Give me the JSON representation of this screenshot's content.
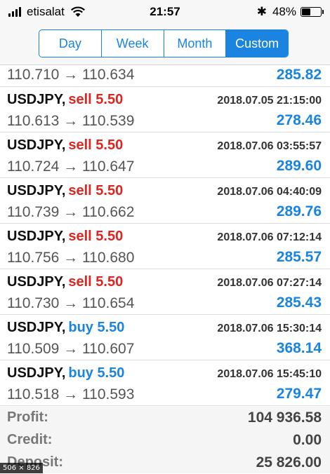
{
  "status": {
    "carrier": "etisalat",
    "time": "21:57",
    "battery": "48%",
    "battery_level": 0.48,
    "bluetooth_glyph": "✱"
  },
  "tabs": [
    {
      "label": "Day",
      "active": false
    },
    {
      "label": "Week",
      "active": false
    },
    {
      "label": "Month",
      "active": false
    },
    {
      "label": "Custom",
      "active": true
    }
  ],
  "trades": [
    {
      "prices": "110.710 → 110.634",
      "profit": "285.82"
    },
    {
      "symbol": "USDJPY,",
      "side": "sell 5.50",
      "time": "2018.07.05 21:15:00",
      "prices": "110.613 → 110.539",
      "profit": "278.46"
    },
    {
      "symbol": "USDJPY,",
      "side": "sell 5.50",
      "time": "2018.07.06 03:55:57",
      "prices": "110.724 → 110.647",
      "profit": "289.60"
    },
    {
      "symbol": "USDJPY,",
      "side": "sell 5.50",
      "time": "2018.07.06 04:40:09",
      "prices": "110.739 → 110.662",
      "profit": "289.76"
    },
    {
      "symbol": "USDJPY,",
      "side": "sell 5.50",
      "time": "2018.07.06 07:12:14",
      "prices": "110.756 → 110.680",
      "profit": "285.57"
    },
    {
      "symbol": "USDJPY,",
      "side": "sell 5.50",
      "time": "2018.07.06 07:27:14",
      "prices": "110.730 → 110.654",
      "profit": "285.43"
    },
    {
      "symbol": "USDJPY,",
      "side": "buy 5.50",
      "time": "2018.07.06 15:30:14",
      "prices": "110.509 → 110.607",
      "profit": "368.14"
    },
    {
      "symbol": "USDJPY,",
      "side": "buy 5.50",
      "time": "2018.07.06 15:45:10",
      "prices": "110.518 → 110.593",
      "profit": "279.47"
    }
  ],
  "summary": {
    "profit_label": "Profit:",
    "profit_value": "104 936.58",
    "credit_label": "Credit:",
    "credit_value": "0.00",
    "deposit_label": "Deposit:",
    "deposit_value": "25 826.00"
  },
  "overlay": {
    "size_badge": "506 × 826"
  },
  "colors": {
    "accent": "#1a84e0",
    "sell": "#e0241f",
    "buy": "#1a84e0"
  }
}
